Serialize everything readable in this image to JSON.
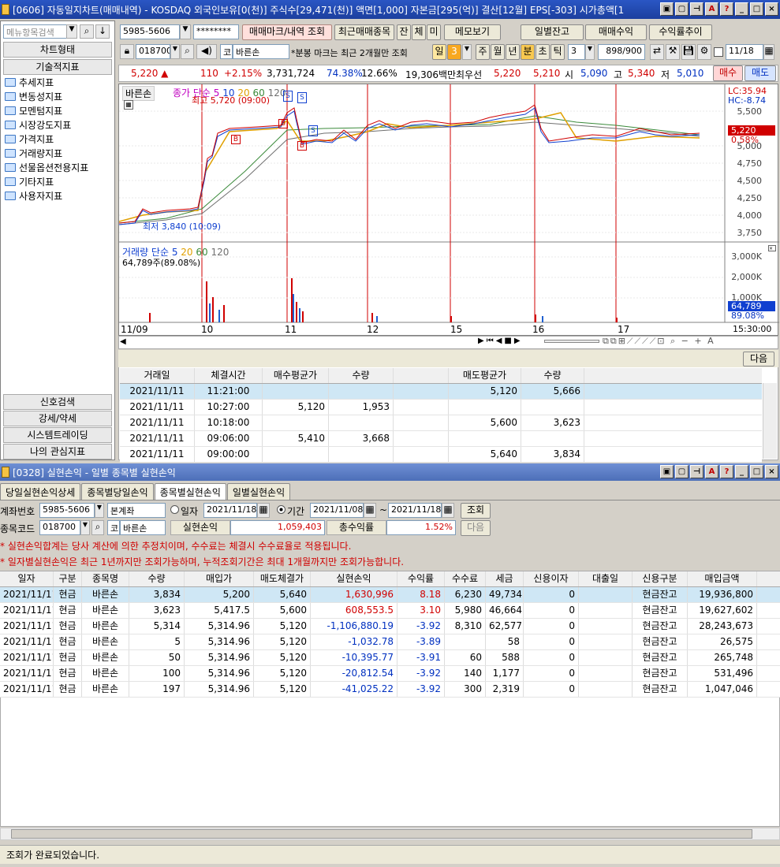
{
  "top_window": {
    "title": "[0606] 자동일지차트(매매내역) - KOSDAQ 외국인보유[0(천)] 주식수[29,471(천)] 액면[1,000] 자본금[295(억)] 결산[12월] EPS[-303] 시가총액[1"
  },
  "left_menu": {
    "search_placeholder": "메뉴항목검색",
    "chart_type": "차트형태",
    "tech_indicator": "기술적지표",
    "items": [
      "추세지표",
      "변동성지표",
      "모멘텀지표",
      "시장강도지표",
      "가격지표",
      "거래량지표",
      "선물옵션전용지표",
      "기타지표",
      "사용자지표"
    ],
    "bottom": [
      "신호검색",
      "강세/약세",
      "시스템트레이딩",
      "나의 관심지표"
    ]
  },
  "toolbar1": {
    "account": "5985-5606",
    "password": "********",
    "mark_btn": "매매마크/내역 조회",
    "recent_btn": "최근매매종목",
    "small_btns": [
      "잔",
      "체",
      "미"
    ],
    "memo_btn": "메모보기",
    "daily_btn": "일별잔고",
    "profit_btn": "매매수익",
    "trend_btn": "수익률추이"
  },
  "toolbar2": {
    "code": "018700",
    "market": "코",
    "name": "바른손",
    "note": "*분봉 마크는 최근 2개월만 조회",
    "period_sel": "일",
    "period_num": "3",
    "periods": [
      "주",
      "월",
      "년",
      "분",
      "초",
      "틱"
    ],
    "tick_num": "3",
    "count": "898/900",
    "date": "11/18"
  },
  "quote": {
    "price": "5,220",
    "change": "110",
    "rate": "+2.15%",
    "volume": "3,731,724",
    "vol_rate": "74.38%",
    "turnover": "12.66%",
    "amount": "19,306백만",
    "label_best": "최우선",
    "ask": "5,220",
    "bid": "5,210",
    "open_lbl": "시",
    "open": "5,090",
    "high_lbl": "고",
    "high": "5,340",
    "low_lbl": "저",
    "low": "5,010",
    "buy": "매수",
    "sell": "매도"
  },
  "chart": {
    "stock_tag": "바른손",
    "ma_title": "종가 단순 5",
    "ma_10": "10",
    "ma_20": "20",
    "ma_60": "60",
    "ma_120": "120",
    "high_note": "최고 5,720 (09:00)",
    "low_note": "최저 3,840 (10:09)",
    "lc": "LC:35.94",
    "hc": "HC:-8.74",
    "price_ticks": [
      "5,500",
      "5,000",
      "4,750",
      "4,500",
      "4,250",
      "4,000",
      "3,750"
    ],
    "price_tag": "5,220",
    "pct_tag": "0.58%",
    "vol_title": "거래량 단순 5",
    "vol_20": "20",
    "vol_60": "60",
    "vol_120": "120",
    "vol_note": "64,789주(89.08%)",
    "vol_ticks": [
      "3,000K",
      "2,000K",
      "1,000K"
    ],
    "vol_tag": "64,789",
    "vol_pct": "89.08%",
    "dates": [
      "11/09",
      "10",
      "11",
      "12",
      "15",
      "16",
      "17"
    ],
    "time": "15:30:00",
    "marks": [
      "B",
      "S",
      "S",
      "B",
      "B",
      "S"
    ]
  },
  "trade_table": {
    "next": "다음",
    "headers": [
      "거래일",
      "체결시간",
      "매수평균가",
      "수량",
      "",
      "매도평균가",
      "수량"
    ],
    "rows": [
      [
        "2021/11/11",
        "11:21:00",
        "",
        "",
        "",
        "5,120",
        "5,666"
      ],
      [
        "2021/11/11",
        "10:27:00",
        "5,120",
        "1,953",
        "",
        "",
        ""
      ],
      [
        "2021/11/11",
        "10:18:00",
        "",
        "",
        "",
        "5,600",
        "3,623"
      ],
      [
        "2021/11/11",
        "09:06:00",
        "5,410",
        "3,668",
        "",
        "",
        ""
      ],
      [
        "2021/11/11",
        "09:00:00",
        "",
        "",
        "",
        "5,640",
        "3,834"
      ]
    ]
  },
  "bottom_window": {
    "title": "[0328] 실현손익 - 일별 종목별 실현손익",
    "tabs": [
      "당일실현손익상세",
      "종목별당일손익",
      "종목별실현손익",
      "일별실현손익"
    ],
    "account_lbl": "계좌번호",
    "account": "5985-5606",
    "account_type": "본계좌",
    "date_lbl": "일자",
    "date": "2021/11/18",
    "period_lbl": "기간",
    "from": "2021/11/08",
    "to": "2021/11/18",
    "query": "조회",
    "code_lbl": "종목코드",
    "code": "018700",
    "market": "코",
    "name": "바른손",
    "pnl_lbl": "실현손익",
    "pnl": "1,059,403",
    "rate_lbl": "총수익률",
    "rate": "1.52%",
    "next": "다음",
    "notice1": "* 실현손익합계는 당사 계산에 의한 추정치이며, 수수료는 체결시 수수료율로 적용됩니다.",
    "notice2": "* 일자별실현손익은 최근 1년까지만 조회가능하며, 누적조회기간은 최대 1개월까지만 조회가능합니다.",
    "headers": [
      "일자",
      "구분",
      "종목명",
      "수량",
      "매입가",
      "매도체결가",
      "실현손익",
      "수익률",
      "수수료",
      "세금",
      "신용이자",
      "대출일",
      "신용구분",
      "매입금액"
    ],
    "rows": [
      [
        "2021/11/11",
        "현금",
        "바른손",
        "3,834",
        "5,200",
        "5,640",
        "1,630,996",
        "8.18",
        "6,230",
        "49,734",
        "0",
        "",
        "현금잔고",
        "19,936,800"
      ],
      [
        "2021/11/11",
        "현금",
        "바른손",
        "3,623",
        "5,417.5",
        "5,600",
        "608,553.5",
        "3.10",
        "5,980",
        "46,664",
        "0",
        "",
        "현금잔고",
        "19,627,602"
      ],
      [
        "2021/11/11",
        "현금",
        "바른손",
        "5,314",
        "5,314.96",
        "5,120",
        "-1,106,880.19",
        "-3.92",
        "8,310",
        "62,577",
        "0",
        "",
        "현금잔고",
        "28,243,673"
      ],
      [
        "2021/11/11",
        "현금",
        "바른손",
        "5",
        "5,314.96",
        "5,120",
        "-1,032.78",
        "-3.89",
        "",
        "58",
        "0",
        "",
        "현금잔고",
        "26,575"
      ],
      [
        "2021/11/11",
        "현금",
        "바른손",
        "50",
        "5,314.96",
        "5,120",
        "-10,395.77",
        "-3.91",
        "60",
        "588",
        "0",
        "",
        "현금잔고",
        "265,748"
      ],
      [
        "2021/11/11",
        "현금",
        "바른손",
        "100",
        "5,314.96",
        "5,120",
        "-20,812.54",
        "-3.92",
        "140",
        "1,177",
        "0",
        "",
        "현금잔고",
        "531,496"
      ],
      [
        "2021/11/11",
        "현금",
        "바른손",
        "197",
        "5,314.96",
        "5,120",
        "-41,025.22",
        "-3.92",
        "300",
        "2,319",
        "0",
        "",
        "현금잔고",
        "1,047,046"
      ]
    ],
    "status": "조회가 완료되었습니다."
  }
}
